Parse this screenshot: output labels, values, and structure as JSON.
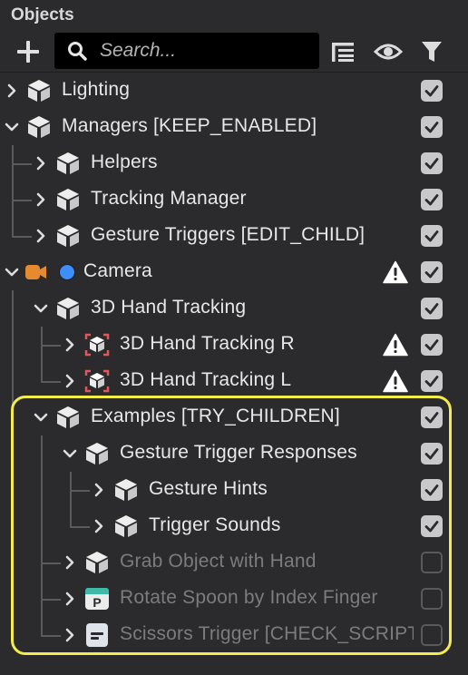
{
  "panel": {
    "title": "Objects"
  },
  "toolbar": {
    "search_placeholder": "Search...",
    "add_icon": "plus-icon",
    "list_icon": "list-icon",
    "visibility_icon": "eye-icon",
    "filter_icon": "filter-icon"
  },
  "colors": {
    "background": "#2b2b2d",
    "checkbox_on": "#c9c9cb",
    "highlight": "#f3ec4e",
    "camera_orange": "#e58a2e",
    "camera_blue": "#3e8ef7",
    "tracking_red": "#e0585b"
  },
  "tree": [
    {
      "label": "Lighting",
      "icon": "scene-object-icon",
      "expanded": false,
      "checked": true,
      "warning": false
    },
    {
      "label": "Managers [KEEP_ENABLED]",
      "icon": "scene-object-icon",
      "expanded": true,
      "checked": true,
      "warning": false
    },
    {
      "label": "Helpers",
      "icon": "scene-object-icon",
      "expanded": false,
      "checked": true,
      "warning": false
    },
    {
      "label": "Tracking Manager",
      "icon": "scene-object-icon",
      "expanded": false,
      "checked": true,
      "warning": false
    },
    {
      "label": "Gesture Triggers [EDIT_CHILD]",
      "icon": "scene-object-icon",
      "expanded": false,
      "checked": true,
      "warning": false
    },
    {
      "label": "Camera",
      "icon": "camera-icon",
      "expanded": true,
      "checked": true,
      "warning": true
    },
    {
      "label": "3D Hand Tracking",
      "icon": "scene-object-icon",
      "expanded": true,
      "checked": true,
      "warning": false
    },
    {
      "label": "3D Hand Tracking R",
      "icon": "tracking-cube-icon",
      "expanded": false,
      "checked": true,
      "warning": true
    },
    {
      "label": "3D Hand Tracking L",
      "icon": "tracking-cube-icon",
      "expanded": false,
      "checked": true,
      "warning": true
    },
    {
      "label": "Examples [TRY_CHILDREN]",
      "icon": "scene-object-icon",
      "expanded": true,
      "checked": true,
      "warning": false
    },
    {
      "label": "Gesture Trigger Responses",
      "icon": "scene-object-icon",
      "expanded": true,
      "checked": true,
      "warning": false
    },
    {
      "label": "Gesture Hints",
      "icon": "scene-object-icon",
      "expanded": false,
      "checked": true,
      "warning": false
    },
    {
      "label": "Trigger Sounds",
      "icon": "scene-object-icon",
      "expanded": false,
      "checked": true,
      "warning": false
    },
    {
      "label": "Grab Object with Hand",
      "icon": "scene-object-icon",
      "expanded": false,
      "checked": false,
      "warning": false
    },
    {
      "label": "Rotate Spoon by Index Finger",
      "icon": "prefab-icon",
      "expanded": false,
      "checked": false,
      "warning": false
    },
    {
      "label": "Scissors Trigger [CHECK_SCRIPT]",
      "icon": "script-icon",
      "expanded": false,
      "checked": false,
      "warning": false
    }
  ]
}
